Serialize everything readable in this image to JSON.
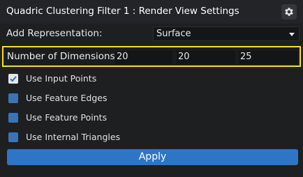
{
  "header": {
    "title": "Quadric Clustering Filter 1 : Render View Settings",
    "settings_icon": "gear-icon"
  },
  "representation": {
    "label": "Add Representation:",
    "selected": "Surface"
  },
  "dimensions": {
    "label": "Number of Dimensions :",
    "values": [
      "20",
      "20",
      "25"
    ],
    "highlight_color": "#f6e21e"
  },
  "options": [
    {
      "label": "Use Input Points",
      "checked": true
    },
    {
      "label": "Use Feature Edges",
      "checked": false
    },
    {
      "label": "Use Feature Points",
      "checked": false
    },
    {
      "label": "Use Internal Triangles",
      "checked": false
    }
  ],
  "actions": {
    "apply_label": "Apply"
  },
  "colors": {
    "accent": "#2e75c6",
    "checkbox_unchecked": "#3b73b9",
    "background": "#1e1f21"
  }
}
